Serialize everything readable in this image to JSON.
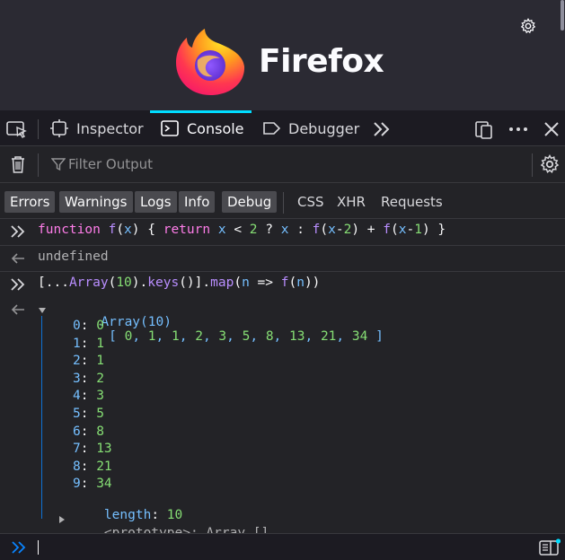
{
  "page": {
    "brand": "Firefox"
  },
  "toolbox": {
    "tabs": [
      {
        "label": "Inspector"
      },
      {
        "label": "Console"
      },
      {
        "label": "Debugger"
      }
    ]
  },
  "filter": {
    "placeholder": "Filter Output"
  },
  "levels": [
    "Errors",
    "Warnings",
    "Logs",
    "Info",
    "Debug"
  ],
  "categories": [
    "CSS",
    "XHR",
    "Requests"
  ],
  "console": {
    "messages": [
      {
        "type": "input",
        "text": "function f(x) { return x < 2 ? x : f(x-2) + f(x-1) }"
      },
      {
        "type": "result",
        "text": "undefined"
      },
      {
        "type": "input",
        "text": "[...Array(10).keys()].map(n => f(n))"
      }
    ],
    "array": {
      "head": "Array(10)",
      "preview": "[ 0, 1, 1, 2, 3, 5, 8, 13, 21, 34 ]",
      "entries": [
        {
          "key": "0",
          "value": "0"
        },
        {
          "key": "1",
          "value": "1"
        },
        {
          "key": "2",
          "value": "1"
        },
        {
          "key": "3",
          "value": "2"
        },
        {
          "key": "4",
          "value": "3"
        },
        {
          "key": "5",
          "value": "5"
        },
        {
          "key": "6",
          "value": "8"
        },
        {
          "key": "7",
          "value": "13"
        },
        {
          "key": "8",
          "value": "21"
        },
        {
          "key": "9",
          "value": "34"
        }
      ],
      "length_key": "length",
      "length_value": "10",
      "prototype_key": "<prototype>",
      "prototype_value": "Array []"
    }
  },
  "colors": {
    "accent": "#00ddff",
    "keyword": "#ff7de9",
    "function": "#b98eff",
    "identifier": "#75bfff",
    "number": "#86de74"
  },
  "icons": [
    "gear-icon",
    "firefox-logo",
    "element-picker-icon",
    "inspector-icon",
    "console-icon",
    "debugger-icon",
    "more-tools-icon",
    "dock-icon",
    "overflow-menu-icon",
    "close-icon",
    "trash-icon",
    "filter-icon",
    "console-settings-icon",
    "input-prompt-icon",
    "result-arrow-icon",
    "sidebar-toggle-icon"
  ]
}
